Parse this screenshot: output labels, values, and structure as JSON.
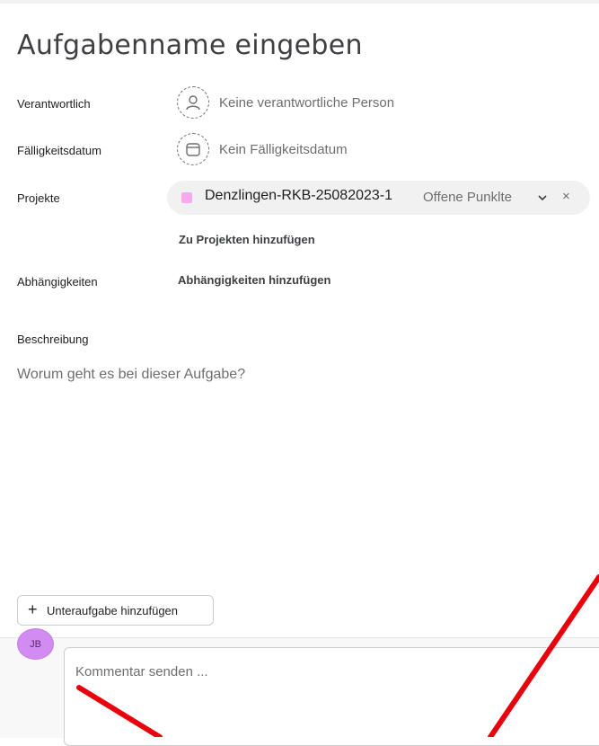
{
  "task": {
    "title": "Aufgabenname eingeben"
  },
  "fields": {
    "assignee": {
      "label": "Verantwortlich",
      "value": "Keine verantwortliche Person",
      "icon": "person-icon"
    },
    "due_date": {
      "label": "Fälligkeitsdatum",
      "value": "Kein Fälligkeitsdatum",
      "icon": "calendar-icon"
    },
    "projects": {
      "label": "Projekte",
      "project_name": "Denzlingen-RKB-25082023-1",
      "section": "Offene Punklte",
      "project_color": "#f9aaef",
      "remove_glyph": "×",
      "add_label": "Zu Projekten hinzufügen"
    },
    "dependencies": {
      "label": "Abhängigkeiten",
      "add_label": "Abhängigkeiten hinzufügen"
    },
    "description": {
      "label": "Beschreibung",
      "placeholder": "Worum geht es bei dieser Aufgabe?"
    }
  },
  "subtask": {
    "plus": "+",
    "label": "Unteraufgabe hinzufügen"
  },
  "comment": {
    "avatar_initials": "JB",
    "placeholder": "Kommentar senden ...",
    "avatar_color": "#d28bf0"
  },
  "annotation": {
    "color": "#e8000d"
  }
}
